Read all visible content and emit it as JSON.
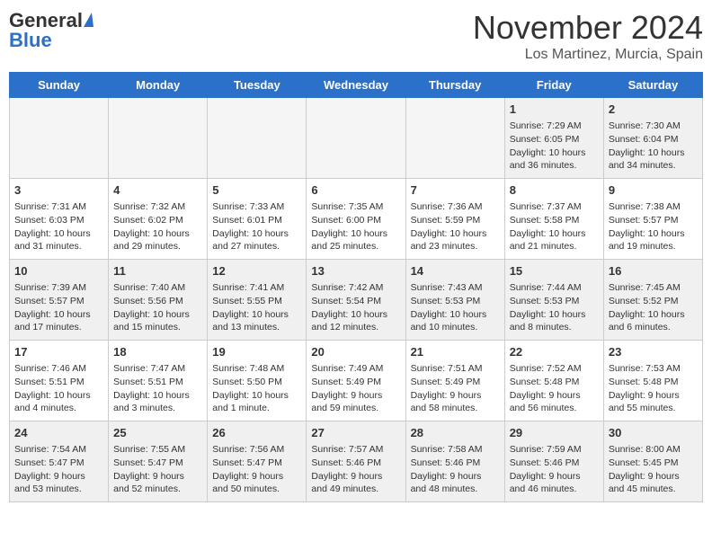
{
  "header": {
    "logo_general": "General",
    "logo_blue": "Blue",
    "month_title": "November 2024",
    "location": "Los Martinez, Murcia, Spain"
  },
  "days_of_week": [
    "Sunday",
    "Monday",
    "Tuesday",
    "Wednesday",
    "Thursday",
    "Friday",
    "Saturday"
  ],
  "weeks": [
    [
      {
        "day": "",
        "empty": true
      },
      {
        "day": "",
        "empty": true
      },
      {
        "day": "",
        "empty": true
      },
      {
        "day": "",
        "empty": true
      },
      {
        "day": "",
        "empty": true
      },
      {
        "day": "1",
        "sunrise": "7:29 AM",
        "sunset": "6:05 PM",
        "daylight": "10 hours and 36 minutes."
      },
      {
        "day": "2",
        "sunrise": "7:30 AM",
        "sunset": "6:04 PM",
        "daylight": "10 hours and 34 minutes."
      }
    ],
    [
      {
        "day": "3",
        "sunrise": "7:31 AM",
        "sunset": "6:03 PM",
        "daylight": "10 hours and 31 minutes."
      },
      {
        "day": "4",
        "sunrise": "7:32 AM",
        "sunset": "6:02 PM",
        "daylight": "10 hours and 29 minutes."
      },
      {
        "day": "5",
        "sunrise": "7:33 AM",
        "sunset": "6:01 PM",
        "daylight": "10 hours and 27 minutes."
      },
      {
        "day": "6",
        "sunrise": "7:35 AM",
        "sunset": "6:00 PM",
        "daylight": "10 hours and 25 minutes."
      },
      {
        "day": "7",
        "sunrise": "7:36 AM",
        "sunset": "5:59 PM",
        "daylight": "10 hours and 23 minutes."
      },
      {
        "day": "8",
        "sunrise": "7:37 AM",
        "sunset": "5:58 PM",
        "daylight": "10 hours and 21 minutes."
      },
      {
        "day": "9",
        "sunrise": "7:38 AM",
        "sunset": "5:57 PM",
        "daylight": "10 hours and 19 minutes."
      }
    ],
    [
      {
        "day": "10",
        "sunrise": "7:39 AM",
        "sunset": "5:57 PM",
        "daylight": "10 hours and 17 minutes."
      },
      {
        "day": "11",
        "sunrise": "7:40 AM",
        "sunset": "5:56 PM",
        "daylight": "10 hours and 15 minutes."
      },
      {
        "day": "12",
        "sunrise": "7:41 AM",
        "sunset": "5:55 PM",
        "daylight": "10 hours and 13 minutes."
      },
      {
        "day": "13",
        "sunrise": "7:42 AM",
        "sunset": "5:54 PM",
        "daylight": "10 hours and 12 minutes."
      },
      {
        "day": "14",
        "sunrise": "7:43 AM",
        "sunset": "5:53 PM",
        "daylight": "10 hours and 10 minutes."
      },
      {
        "day": "15",
        "sunrise": "7:44 AM",
        "sunset": "5:53 PM",
        "daylight": "10 hours and 8 minutes."
      },
      {
        "day": "16",
        "sunrise": "7:45 AM",
        "sunset": "5:52 PM",
        "daylight": "10 hours and 6 minutes."
      }
    ],
    [
      {
        "day": "17",
        "sunrise": "7:46 AM",
        "sunset": "5:51 PM",
        "daylight": "10 hours and 4 minutes."
      },
      {
        "day": "18",
        "sunrise": "7:47 AM",
        "sunset": "5:51 PM",
        "daylight": "10 hours and 3 minutes."
      },
      {
        "day": "19",
        "sunrise": "7:48 AM",
        "sunset": "5:50 PM",
        "daylight": "10 hours and 1 minute."
      },
      {
        "day": "20",
        "sunrise": "7:49 AM",
        "sunset": "5:49 PM",
        "daylight": "9 hours and 59 minutes."
      },
      {
        "day": "21",
        "sunrise": "7:51 AM",
        "sunset": "5:49 PM",
        "daylight": "9 hours and 58 minutes."
      },
      {
        "day": "22",
        "sunrise": "7:52 AM",
        "sunset": "5:48 PM",
        "daylight": "9 hours and 56 minutes."
      },
      {
        "day": "23",
        "sunrise": "7:53 AM",
        "sunset": "5:48 PM",
        "daylight": "9 hours and 55 minutes."
      }
    ],
    [
      {
        "day": "24",
        "sunrise": "7:54 AM",
        "sunset": "5:47 PM",
        "daylight": "9 hours and 53 minutes."
      },
      {
        "day": "25",
        "sunrise": "7:55 AM",
        "sunset": "5:47 PM",
        "daylight": "9 hours and 52 minutes."
      },
      {
        "day": "26",
        "sunrise": "7:56 AM",
        "sunset": "5:47 PM",
        "daylight": "9 hours and 50 minutes."
      },
      {
        "day": "27",
        "sunrise": "7:57 AM",
        "sunset": "5:46 PM",
        "daylight": "9 hours and 49 minutes."
      },
      {
        "day": "28",
        "sunrise": "7:58 AM",
        "sunset": "5:46 PM",
        "daylight": "9 hours and 48 minutes."
      },
      {
        "day": "29",
        "sunrise": "7:59 AM",
        "sunset": "5:46 PM",
        "daylight": "9 hours and 46 minutes."
      },
      {
        "day": "30",
        "sunrise": "8:00 AM",
        "sunset": "5:45 PM",
        "daylight": "9 hours and 45 minutes."
      }
    ]
  ]
}
